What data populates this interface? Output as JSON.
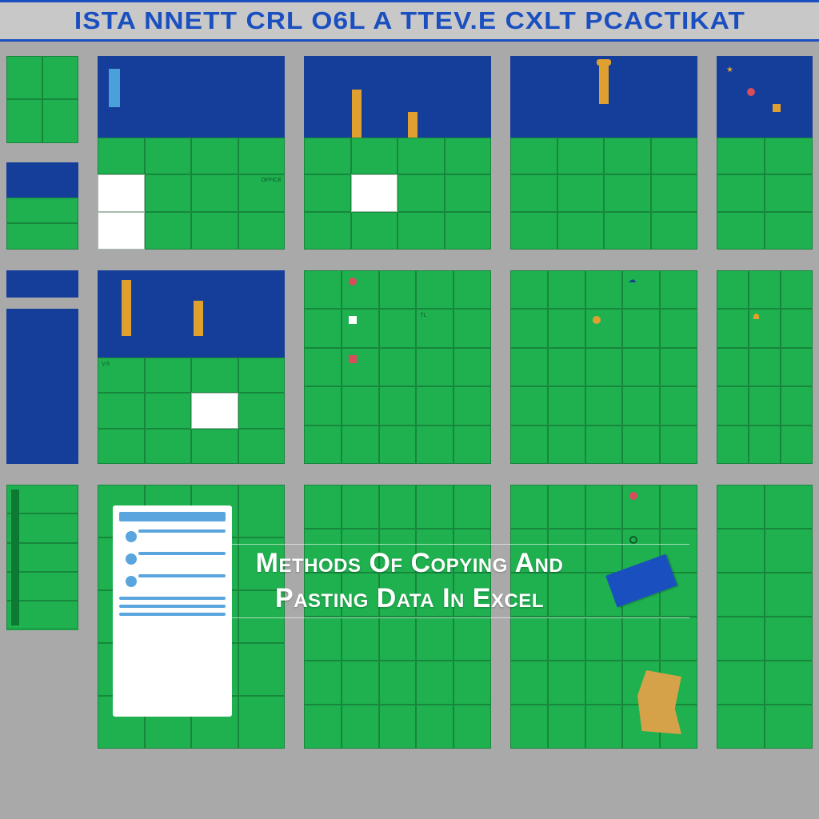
{
  "banner": {
    "text": "ISTA NNETT CRL O6L A TTEV.E CXLT PCACTIKAT"
  },
  "overlay": {
    "line1": "Methods Of Copying And",
    "line2": "Pasting Data In Excel"
  },
  "colors": {
    "green": "#1fb04f",
    "blue": "#153e9b",
    "gray": "#a9a9a9",
    "accentBlue": "#1a4fc0",
    "orange": "#e0a030"
  },
  "labels": {
    "office": "OFFICE",
    "v6": "V.6",
    "tl": "TL"
  }
}
